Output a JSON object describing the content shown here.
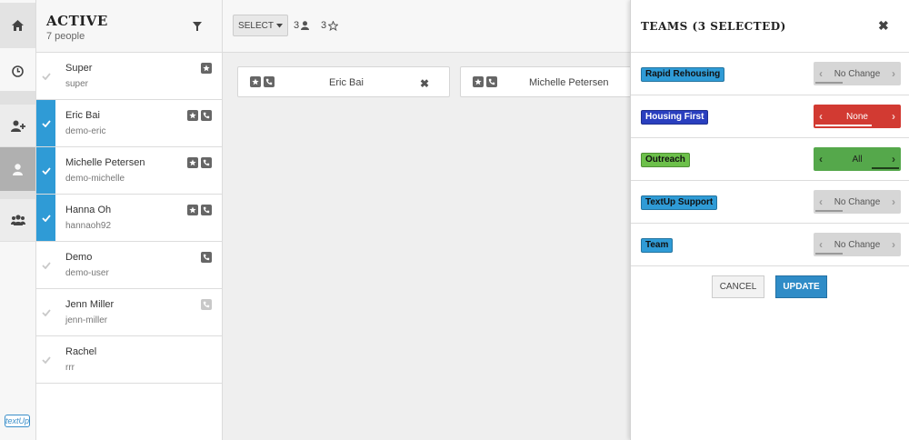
{
  "list": {
    "title": "ACTIVE",
    "count": "7 people",
    "contacts": [
      {
        "name": "Super",
        "sub": "super",
        "selected": false
      },
      {
        "name": "Eric Bai",
        "sub": "demo-eric",
        "selected": true
      },
      {
        "name": "Michelle Petersen",
        "sub": "demo-michelle",
        "selected": true
      },
      {
        "name": "Hanna Oh",
        "sub": "hannaoh92",
        "selected": true
      },
      {
        "name": "Demo",
        "sub": "demo-user",
        "selected": false
      },
      {
        "name": "Jenn Miller",
        "sub": "jenn-miller",
        "selected": false
      },
      {
        "name": "Rachel",
        "sub": "rrr",
        "selected": false
      }
    ]
  },
  "toolbar": {
    "select_label": "SELECT",
    "people_count": "3",
    "star_count": "3"
  },
  "cards": [
    {
      "name": "Eric Bai"
    },
    {
      "name": "Michelle Petersen"
    }
  ],
  "panel": {
    "title": "TEAMS (3 SELECTED)",
    "teams": [
      {
        "name": "Rapid Rehousing",
        "state": "No Change",
        "tag_color": "#2f9bd6"
      },
      {
        "name": "Housing First",
        "state": "None",
        "tag_color": "#2a3fbf"
      },
      {
        "name": "Outreach",
        "state": "All",
        "tag_color": "#6cc04a"
      },
      {
        "name": "TextUp Support",
        "state": "No Change",
        "tag_color": "#2f9bd6"
      },
      {
        "name": "Team",
        "state": "No Change",
        "tag_color": "#2f9bd6"
      }
    ],
    "cancel_label": "CANCEL",
    "update_label": "UPDATE"
  },
  "logo_text": "textUp",
  "colors": {
    "accent": "#2f9bd6",
    "none_red": "#d23a32",
    "all_green": "#55a84b",
    "nochange_gray": "#d6d6d6"
  }
}
